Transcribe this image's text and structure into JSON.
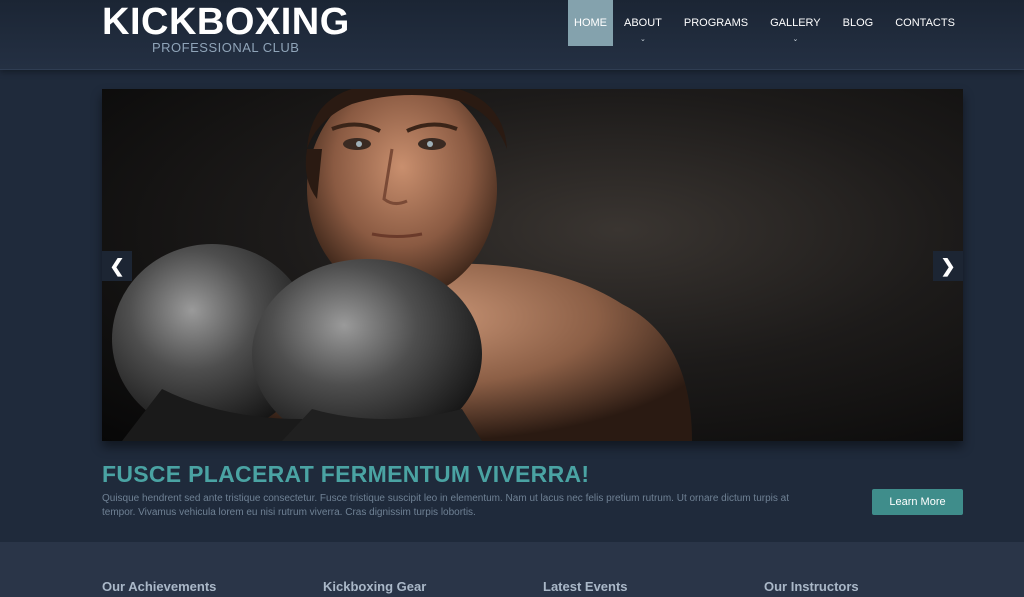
{
  "logo": {
    "title": "KICKBOXING",
    "subtitle": "PROFESSIONAL CLUB"
  },
  "nav": {
    "items": [
      {
        "label": "HOME",
        "active": true,
        "has_submenu": false
      },
      {
        "label": "ABOUT",
        "active": false,
        "has_submenu": true
      },
      {
        "label": "PROGRAMS",
        "active": false,
        "has_submenu": false
      },
      {
        "label": "GALLERY",
        "active": false,
        "has_submenu": true
      },
      {
        "label": "BLOG",
        "active": false,
        "has_submenu": false
      },
      {
        "label": "CONTACTS",
        "active": false,
        "has_submenu": false
      }
    ]
  },
  "slider": {
    "prev_icon": "chevron-left-icon",
    "next_icon": "chevron-right-icon",
    "prev_glyph": "❮",
    "next_glyph": "❯"
  },
  "caption": {
    "title": "FUSCE PLACERAT FERMENTUM VIVERRA!",
    "text": "Quisque hendrent sed ante tristique consectetur. Fusce tristique suscipit leo in elementum. Nam ut lacus nec felis pretium rutrum. Ut ornare dictum turpis at tempor. Vivamus vehicula lorem eu nisi rutrum viverra. Cras dignissim turpis lobortis.",
    "button_label": "Learn More"
  },
  "footer": {
    "columns": [
      {
        "title": "Our Achievements"
      },
      {
        "title": "Kickboxing Gear"
      },
      {
        "title": "Latest Events"
      },
      {
        "title": "Our Instructors"
      }
    ]
  },
  "colors": {
    "background": "#1f2a3b",
    "accent": "#4aa3a3",
    "button": "#3f8d8b",
    "nav_active": "#84a2ad"
  }
}
